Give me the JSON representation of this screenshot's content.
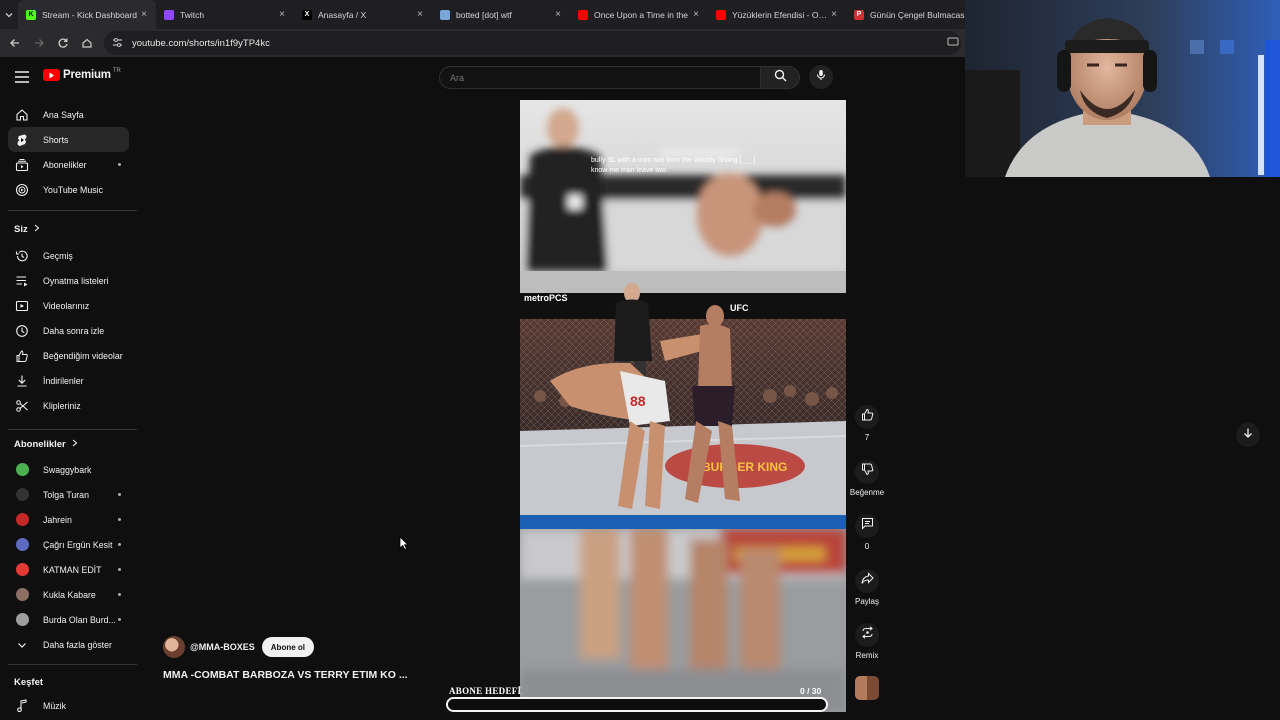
{
  "browser": {
    "tabs": [
      {
        "title": "Stream - Kick Dashboard",
        "icon": "kick-icon",
        "color": "#53fc18",
        "glyph": "K",
        "active": true
      },
      {
        "title": "Twitch",
        "icon": "twitch-icon",
        "color": "#9146ff",
        "glyph": ""
      },
      {
        "title": "Anasayfa / X",
        "icon": "x-icon",
        "color": "#000000",
        "glyph": "X"
      },
      {
        "title": "botted [dot] wtf",
        "icon": "bot-icon",
        "color": "#7aa7d8",
        "glyph": ""
      },
      {
        "title": "Once Upon a Time in the",
        "icon": "youtube-icon",
        "color": "#ff0000",
        "glyph": ""
      },
      {
        "title": "Yüzüklerin Efendisi - Orta",
        "icon": "youtube-icon",
        "color": "#ff0000",
        "glyph": ""
      },
      {
        "title": "Günün Çengel Bulmacası",
        "icon": "p-icon",
        "color": "#d32f2f",
        "glyph": "P"
      }
    ],
    "url": "youtube.com/shorts/in1f9yTP4kc"
  },
  "header": {
    "logo_text": "Premium",
    "country": "TR",
    "search_placeholder": "Ara"
  },
  "sidebar": {
    "main": [
      {
        "label": "Ana Sayfa",
        "icon": "home-icon"
      },
      {
        "label": "Shorts",
        "icon": "shorts-icon",
        "selected": true
      },
      {
        "label": "Abonelikler",
        "icon": "subscriptions-icon",
        "dot": true
      },
      {
        "label": "YouTube Music",
        "icon": "music-circle-icon"
      }
    ],
    "you_header": "Siz",
    "you": [
      {
        "label": "Geçmiş",
        "icon": "history-icon"
      },
      {
        "label": "Oynatma listeleri",
        "icon": "playlists-icon"
      },
      {
        "label": "Videolarınız",
        "icon": "your-videos-icon"
      },
      {
        "label": "Daha sonra izle",
        "icon": "watch-later-icon"
      },
      {
        "label": "Beğendiğim videolar",
        "icon": "liked-icon"
      },
      {
        "label": "İndirilenler",
        "icon": "downloads-icon"
      },
      {
        "label": "Klipleriniz",
        "icon": "clips-icon"
      }
    ],
    "subs_header": "Abonelikler",
    "subs": [
      {
        "label": "Swaggybark",
        "color": "#4caf50",
        "dot": false
      },
      {
        "label": "Tolga Turan",
        "color": "#333333",
        "dot": true
      },
      {
        "label": "Jahrein",
        "color": "#c62828",
        "dot": true
      },
      {
        "label": "Çağrı Ergün Kesit",
        "color": "#5c6bc0",
        "dot": true
      },
      {
        "label": "KATMAN EDİT",
        "color": "#e53935",
        "dot": true
      },
      {
        "label": "Kukla Kabare",
        "color": "#8d6e63",
        "dot": true
      },
      {
        "label": "Burda Olan Burd...",
        "color": "#9e9e9e",
        "dot": true
      }
    ],
    "show_more": "Daha fazla göster",
    "explore_header": "Keşfet",
    "explore": [
      {
        "label": "Müzik",
        "icon": "music-note-icon"
      }
    ]
  },
  "short": {
    "caption": "bully SL with a man two from the Woody Shang [ __ ] know me man leave two",
    "channel": "@MMA-BOXES",
    "subscribe": "Abone ol",
    "title": "MMA -COMBAT BARBOZA VS TERRY ETIM KO ...",
    "actions": {
      "like_count": "7",
      "dislike": "Beğenme",
      "comment_count": "0",
      "share": "Paylaş",
      "remix": "Remix"
    }
  },
  "overlay": {
    "goal_label": "ABONE HEDEFİ",
    "goal_count": "0  / 30",
    "goal_progress": 0
  }
}
